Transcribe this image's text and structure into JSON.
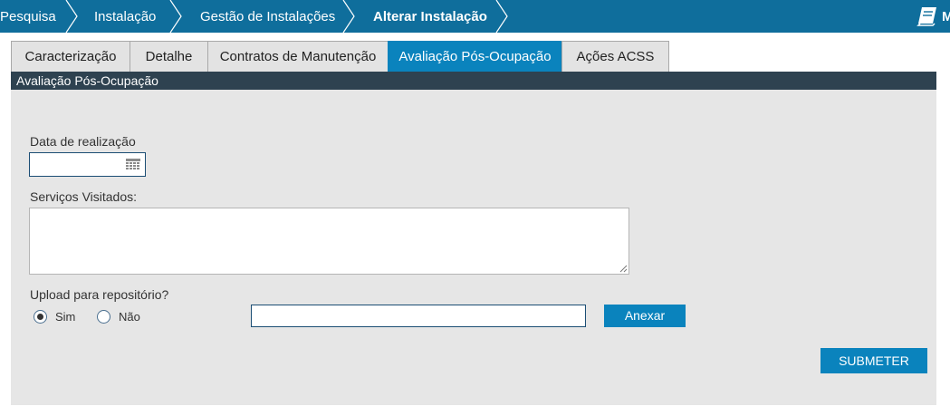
{
  "breadcrumb": {
    "items": [
      "Pesquisa",
      "Instalação",
      "Gestão de Instalações",
      "Alterar Instalação"
    ],
    "manual_label": "M"
  },
  "tabs": [
    "Caracterização",
    "Detalhe",
    "Contratos de Manutenção",
    "Avaliação Pós-Ocupação",
    "Ações ACSS"
  ],
  "active_tab": "Avaliação Pós-Ocupação",
  "section": {
    "title": "Avaliação Pós-Ocupação"
  },
  "form": {
    "date_label": "Data de realização",
    "date_value": "",
    "services_label": "Serviços Visitados:",
    "services_value": "",
    "upload_label": "Upload para repositório?",
    "upload_options": [
      "Sim",
      "Não"
    ],
    "upload_selected": "Sim",
    "file_value": "",
    "attach_label": "Anexar",
    "submit_label": "SUBMETER"
  },
  "colors": {
    "topbar": "#0f6e9c",
    "accent": "#0a83bd",
    "section_header": "#2e4250",
    "panel": "#e6e6e6"
  }
}
